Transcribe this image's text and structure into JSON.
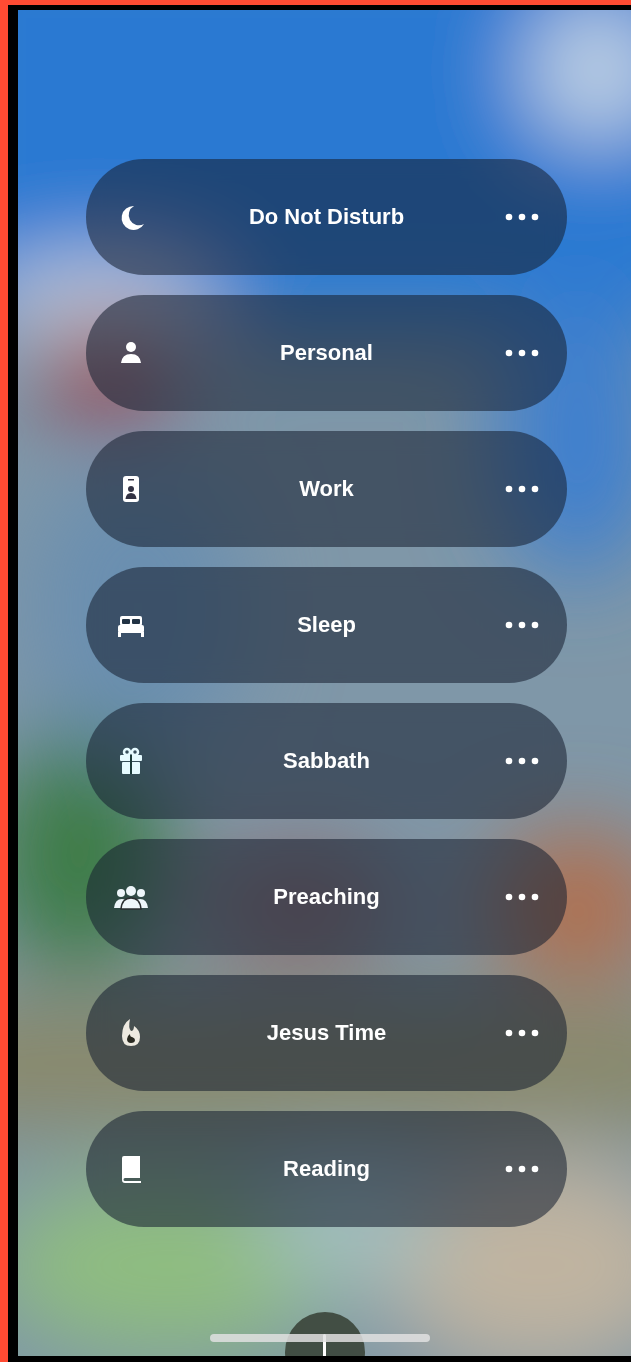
{
  "focus_modes": [
    {
      "label": "Do Not Disturb"
    },
    {
      "label": "Personal"
    },
    {
      "label": "Work"
    },
    {
      "label": "Sleep"
    },
    {
      "label": "Sabbath"
    },
    {
      "label": "Preaching"
    },
    {
      "label": "Jesus Time"
    },
    {
      "label": "Reading"
    }
  ]
}
